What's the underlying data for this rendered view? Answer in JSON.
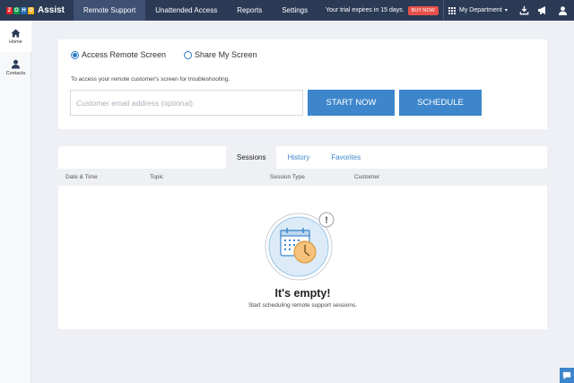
{
  "app": {
    "logo_letters": [
      "Z",
      "O",
      "H",
      "O"
    ],
    "logo_colors": [
      "#e42527",
      "#089949",
      "#226db4",
      "#f9b21d"
    ],
    "name": "Assist"
  },
  "nav": {
    "tabs": [
      {
        "label": "Remote Support",
        "active": true
      },
      {
        "label": "Unattended Access",
        "active": false
      },
      {
        "label": "Reports",
        "active": false
      },
      {
        "label": "Settings",
        "active": false
      }
    ]
  },
  "trial": {
    "text": "Your trial expires in 15 days.",
    "buy_label": "BUY NOW"
  },
  "department": {
    "label": "My Department"
  },
  "top_icons": [
    "download-icon",
    "megaphone-icon",
    "user-icon"
  ],
  "sidebar": {
    "items": [
      {
        "label": "Home",
        "icon": "home-icon",
        "active": true
      },
      {
        "label": "Contacts",
        "icon": "contacts-icon",
        "active": false
      }
    ]
  },
  "session_start": {
    "options": [
      {
        "label": "Access Remote Screen",
        "checked": true
      },
      {
        "label": "Share My Screen",
        "checked": false
      }
    ],
    "hint": "To access your remote customer's screen for troubleshooting.",
    "email_placeholder": "Customer email address (optional)",
    "email_value": "",
    "start_label": "START NOW",
    "schedule_label": "SCHEDULE"
  },
  "sessions": {
    "tabs": [
      {
        "label": "Sessions",
        "active": true
      },
      {
        "label": "History",
        "active": false
      },
      {
        "label": "Favorites",
        "active": false
      }
    ],
    "columns": [
      "Date & Time",
      "Topic",
      "Session Type",
      "Customer"
    ],
    "empty_title": "It's empty!",
    "empty_subtitle": "Start scheduling remote support sessions.",
    "empty_badge": "!"
  },
  "colors": {
    "topbar": "#2b3a55",
    "accent": "#3d86cb",
    "buy_now": "#e8514a"
  }
}
